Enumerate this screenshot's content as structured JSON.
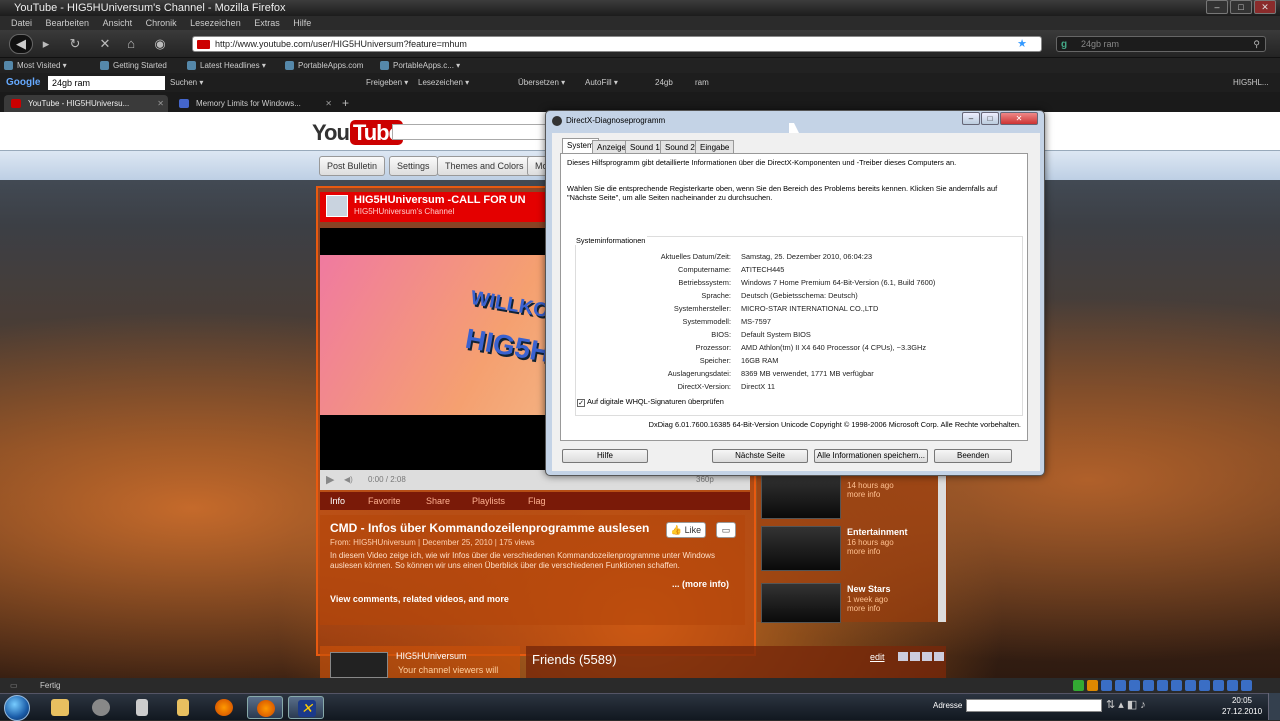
{
  "window": {
    "title": "YouTube - HIG5HUniversum's Channel - Mozilla Firefox"
  },
  "menu": [
    "Datei",
    "Bearbeiten",
    "Ansicht",
    "Chronik",
    "Lesezeichen",
    "Extras",
    "Hilfe"
  ],
  "nav": {
    "url": "http://www.youtube.com/user/HIG5HUniversum?feature=mhum",
    "search_value": "24gb ram"
  },
  "bookmarks": [
    "Most Visited ▾",
    "Getting Started",
    "Latest Headlines ▾",
    "PortableApps.com",
    "PortableApps.c... ▾"
  ],
  "google_toolbar": {
    "logo": "Google",
    "query": "24gb ram",
    "items": [
      "Suchen ▾",
      "Freigeben ▾",
      "Lesezeichen ▾",
      "Übersetzen ▾",
      "AutoFill ▾",
      "24gb",
      "ram"
    ],
    "right": "HIG5HL..."
  },
  "tabs": [
    {
      "label": "YouTube - HIG5HUniversu..."
    },
    {
      "label": "Memory Limits for Windows..."
    }
  ],
  "youtube": {
    "logo_you": "You",
    "logo_tube": "Tube",
    "nav": [
      "Post Bulletin",
      "Settings",
      "Themes and Colors",
      "Mo"
    ],
    "channel_name": "HIG5HUniversum -CALL FOR UN",
    "channel_sub": "HIG5HUniversum's Channel",
    "video_overlay_1": "WILLKOM",
    "video_overlay_2": "HIG5H",
    "player_time": "0:00 / 2:08",
    "player_hd": "360p",
    "info_tabs": [
      "Info",
      "Favorite",
      "Share",
      "Playlists",
      "Flag"
    ],
    "video_title": "CMD - Infos über Kommandozeilenprogramme auslesen",
    "video_meta": "From: HIG5HUniversum | December 25, 2010 | 175 views",
    "video_desc": "In diesem Video zeige ich, wie wir Infos über die verschiedenen Kommandozeilenprogramme unter Windows auslesen können. So können wir uns einen Überblick über die verschiedenen Funktionen schaffen.",
    "more_info": "... (more info)",
    "view_comments": "View comments, related videos, and more",
    "like_label": "Like",
    "side_items": [
      {
        "title": "",
        "sub1": "14 hours ago",
        "sub2": "more info"
      },
      {
        "title": "Entertainment",
        "sub1": "16 hours ago",
        "sub2": "more info"
      },
      {
        "title": "New Stars",
        "sub1": "1 week ago",
        "sub2": "more info"
      }
    ],
    "lower_name": "HIG5HUniversum",
    "lower_text": "Your channel viewers will",
    "friends": "Friends (5589)",
    "friends_edit": "edit"
  },
  "dialog": {
    "title": "DirectX-Diagnoseprogramm",
    "tabs": [
      "System",
      "Anzeige",
      "Sound 1",
      "Sound 2",
      "Eingabe"
    ],
    "intro1": "Dieses Hilfsprogramm gibt detaillierte Informationen über die DirectX-Komponenten und -Treiber dieses Computers an.",
    "intro2": "Wählen Sie die entsprechende Registerkarte oben, wenn Sie den Bereich des Problems bereits kennen. Klicken Sie andernfalls auf \"Nächste Seite\", um alle Seiten nacheinander zu durchsuchen.",
    "section": "Systeminformationen",
    "rows": [
      {
        "label": "Aktuelles Datum/Zeit:",
        "value": "Samstag, 25. Dezember 2010, 06:04:23"
      },
      {
        "label": "Computername:",
        "value": "ATITECH445"
      },
      {
        "label": "Betriebssystem:",
        "value": "Windows 7 Home Premium 64-Bit-Version (6.1, Build 7600)"
      },
      {
        "label": "Sprache:",
        "value": "Deutsch (Gebietsschema: Deutsch)"
      },
      {
        "label": "Systemhersteller:",
        "value": "MICRO-STAR INTERNATIONAL CO.,LTD"
      },
      {
        "label": "Systemmodell:",
        "value": "MS-7597"
      },
      {
        "label": "BIOS:",
        "value": "Default System BIOS"
      },
      {
        "label": "Prozessor:",
        "value": "AMD Athlon(tm) II X4 640 Processor (4 CPUs), ~3.3GHz"
      },
      {
        "label": "Speicher:",
        "value": "16GB RAM"
      },
      {
        "label": "Auslagerungsdatei:",
        "value": "8369 MB verwendet, 1771 MB verfügbar"
      },
      {
        "label": "DirectX-Version:",
        "value": "DirectX 11"
      }
    ],
    "whql": "Auf digitale WHQL-Signaturen überprüfen",
    "whql_checked": true,
    "version": "DxDiag 6.01.7600.16385 64-Bit-Version Unicode Copyright © 1998-2006 Microsoft Corp. Alle Rechte vorbehalten.",
    "buttons": {
      "help": "Hilfe",
      "next": "Nächste Seite",
      "save": "Alle Informationen speichern...",
      "exit": "Beenden"
    }
  },
  "statusbar": {
    "text": "Fertig"
  },
  "taskbar": {
    "address_label": "Adresse",
    "time": "20:05",
    "date": "27.12.2010"
  }
}
